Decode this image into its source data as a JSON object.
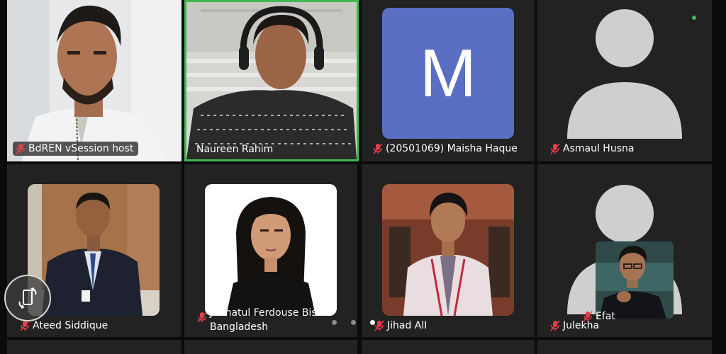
{
  "meeting": {
    "participants": [
      {
        "name": "BdREN vSession host",
        "muted": true,
        "kind": "video"
      },
      {
        "name": "Naureen Rahim",
        "muted": false,
        "kind": "video",
        "speaking": true
      },
      {
        "name": "(20501069) Maisha Haque",
        "muted": true,
        "kind": "initial",
        "initial": "M",
        "avatar_color": "#5a6fc4"
      },
      {
        "name": "Asmaul Husna",
        "muted": true,
        "kind": "placeholder"
      },
      {
        "name": "Ateed Siddique",
        "muted": true,
        "kind": "photo"
      },
      {
        "name_line1": "Jannatul Ferdouse Bisma",
        "name_line2": "Bangladesh",
        "muted": true,
        "kind": "photo"
      },
      {
        "name": "Jihad AlI",
        "muted": true,
        "kind": "photo"
      },
      {
        "name": "Julekha",
        "muted": true,
        "kind": "placeholder"
      }
    ],
    "self_view": {
      "name": "Efat",
      "muted": true
    },
    "pagination": {
      "pages": 3,
      "current": 3
    }
  },
  "colors": {
    "tile_bg": "#222222",
    "speaking_border": "#3fb950",
    "muted_icon": "#e0404a",
    "avatar_placeholder": "#cfcfcf"
  },
  "icons": {
    "muted": "mic-off-icon",
    "rotate": "screen-rotate-icon",
    "placeholder": "person-silhouette-icon"
  }
}
